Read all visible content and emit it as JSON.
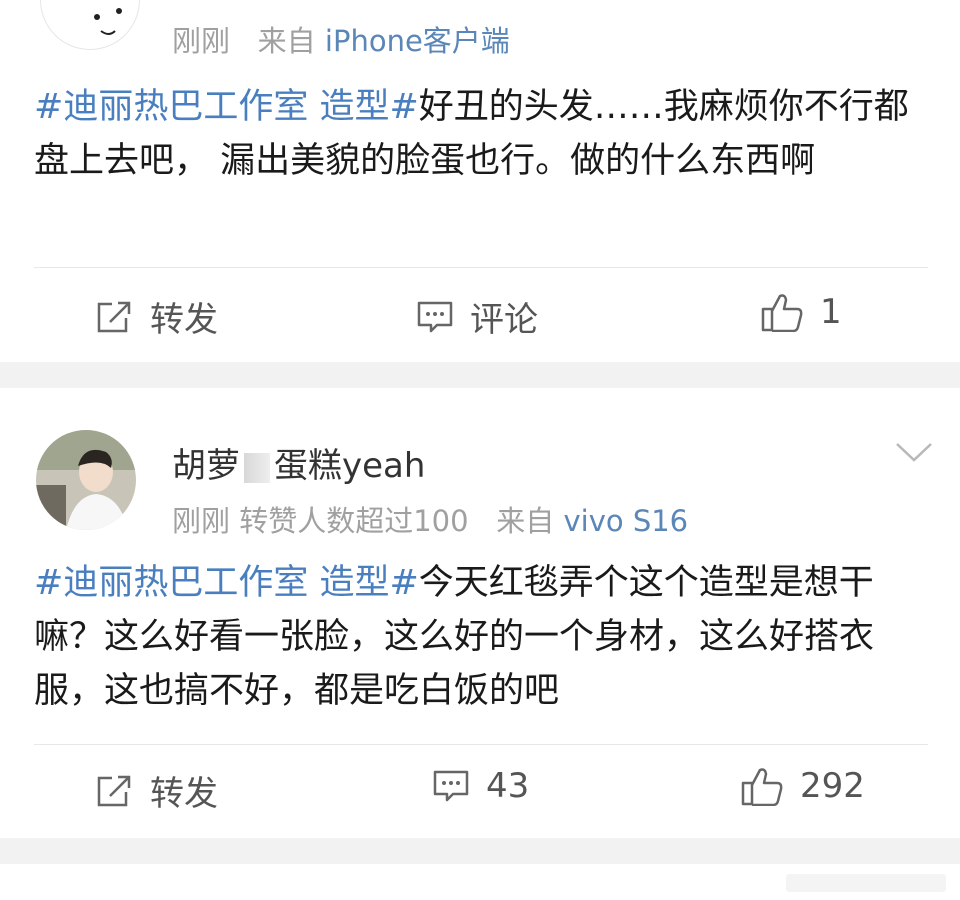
{
  "post1": {
    "meta_time": "刚刚",
    "meta_source_prefix": "来自",
    "meta_source": "iPhone客户端",
    "hashtag": "#迪丽热巴工作室 造型#",
    "body": "好丑的头发……我麻烦你不行都盘上去吧， 漏出美貌的脸蛋也行。做的什么东西啊",
    "actions": {
      "repost_label": "转发",
      "comment_label": "评论",
      "like_count": "1"
    }
  },
  "post2": {
    "username_visible": "胡萝",
    "username_visible2": "蛋糕yeah",
    "meta_time": "刚刚",
    "meta_likes": "转赞人数超过100",
    "meta_source_prefix": "来自",
    "meta_source": "vivo S16",
    "hashtag": "#迪丽热巴工作室 造型#",
    "body": "今天红毯弄个这个造型是想干嘛？这么好看一张脸，这么好的一个身材，这么好搭衣服，这也搞不好，都是吃白饭的吧",
    "actions": {
      "repost_label": "转发",
      "comment_count": "43",
      "like_count": "292"
    }
  },
  "colors": {
    "link": "#4a7fbf",
    "meta": "#a0a0a0",
    "background": "#f2f2f2"
  }
}
